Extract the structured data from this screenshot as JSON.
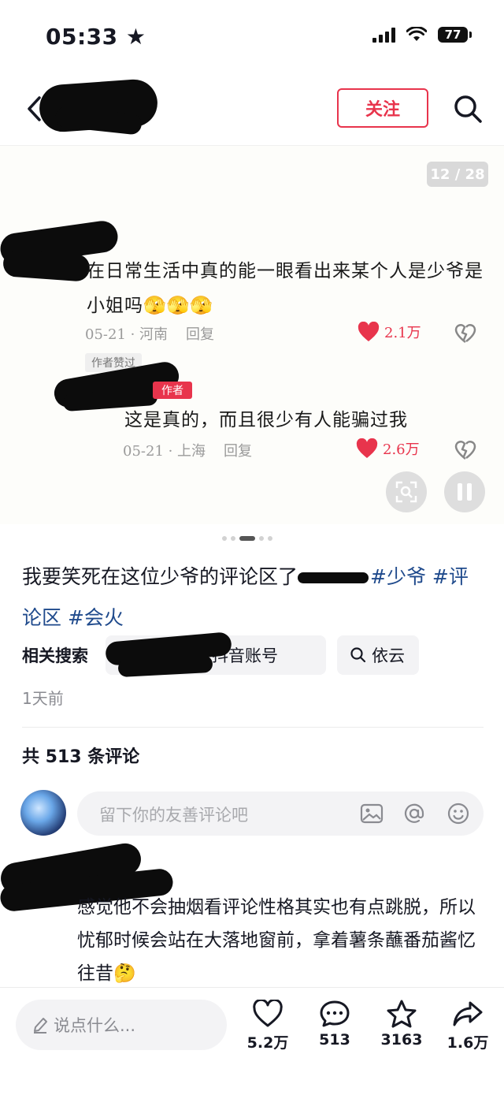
{
  "status_bar": {
    "time": "05:33",
    "battery": "77"
  },
  "header": {
    "follow_label": "关注"
  },
  "slide": {
    "page_counter": "12 / 28",
    "comment1": {
      "text": "在日常生活中真的能一眼看出来某个人是少爷是小姐吗🫣🫣🫣",
      "date": "05-21 · 河南",
      "reply": "回复",
      "likes": "2.1万"
    },
    "author_liked": "作者赞过",
    "author_tag": "作者",
    "comment2": {
      "text": "这是真的，而且很少有人能骗过我",
      "date": "05-21 · 上海",
      "reply": "回复",
      "likes": "2.6万"
    }
  },
  "description": {
    "text": "我要笑死在这位少爷的评论区了",
    "tags": [
      "#少爷",
      "#评论区",
      "#会火"
    ]
  },
  "related": {
    "label": "相关搜索",
    "chip1": "人抖音账号",
    "chip2": "依云"
  },
  "time_ago": "1天前",
  "comments": {
    "count": "共 513 条评论",
    "placeholder": "留下你的友善评论吧",
    "first_comment": "感觉他不会抽烟看评论性格其实也有点跳脱，所以忧郁时候会站在大落地窗前，拿着薯条蘸番茄酱忆往昔🤔"
  },
  "bottom_bar": {
    "say_placeholder": "说点什么...",
    "likes": "5.2万",
    "comments": "513",
    "favorites": "3163",
    "shares": "1.6万"
  },
  "colors": {
    "accent": "#e8344c",
    "tag": "#1f4a8c"
  }
}
